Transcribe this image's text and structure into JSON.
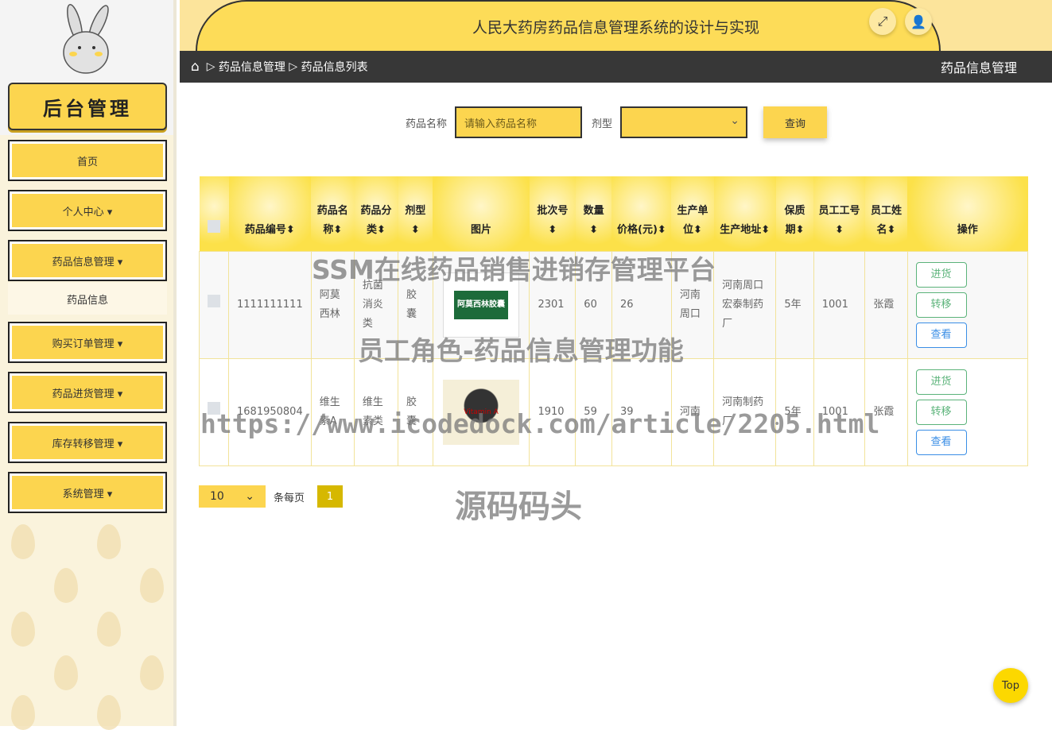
{
  "sidebar": {
    "logo": "后台管理",
    "items": [
      {
        "label": "首页"
      },
      {
        "label": "个人中心 ▾"
      },
      {
        "label": "药品信息管理 ▾",
        "sub": "药品信息"
      },
      {
        "label": "购买订单管理 ▾"
      },
      {
        "label": "药品进货管理 ▾"
      },
      {
        "label": "库存转移管理 ▾"
      },
      {
        "label": "系统管理 ▾"
      }
    ]
  },
  "header": {
    "title": "人民大药房药品信息管理系统的设计与实现"
  },
  "breadcrumb": {
    "items": [
      "药品信息管理",
      "药品信息列表"
    ],
    "right": "药品信息管理"
  },
  "search": {
    "name_label": "药品名称",
    "name_placeholder": "请输入药品名称",
    "type_label": "剂型",
    "type_value": "",
    "query": "查询"
  },
  "table": {
    "headers": [
      "药品编号",
      "药品名称",
      "药品分类",
      "剂型",
      "图片",
      "批次号",
      "数量",
      "价格(元)",
      "生产单位",
      "生产地址",
      "保质期",
      "员工工号",
      "员工姓名",
      "操作"
    ],
    "rows": [
      {
        "id": "1111111111",
        "name": "阿莫西林",
        "cat": "抗菌消炎类",
        "form": "胶囊",
        "img": "阿莫西林胶囊",
        "batch": "2301",
        "qty": "60",
        "price": "26",
        "unit": "河南周口",
        "addr": "河南周口宏泰制药厂",
        "shelf": "5年",
        "emp_no": "1001",
        "emp_name": "张霞"
      },
      {
        "id": "1681950804",
        "name": "维生素A",
        "cat": "维生素类",
        "form": "胶囊",
        "img": "Vitamin A",
        "batch": "1910",
        "qty": "59",
        "price": "39",
        "unit": "河南",
        "addr": "河南制药厂",
        "shelf": "5年",
        "emp_no": "1001",
        "emp_name": "张霞"
      }
    ],
    "actions": [
      "进货",
      "转移",
      "查看"
    ]
  },
  "pager": {
    "page_size": "10",
    "per_page": "条每页",
    "page": "1"
  },
  "watermarks": [
    "SSM在线药品销售进销存管理平台",
    "员工角色-药品信息管理功能",
    "https://www.icodedock.com/article/2205.html",
    "源码码头"
  ],
  "top": "Top"
}
